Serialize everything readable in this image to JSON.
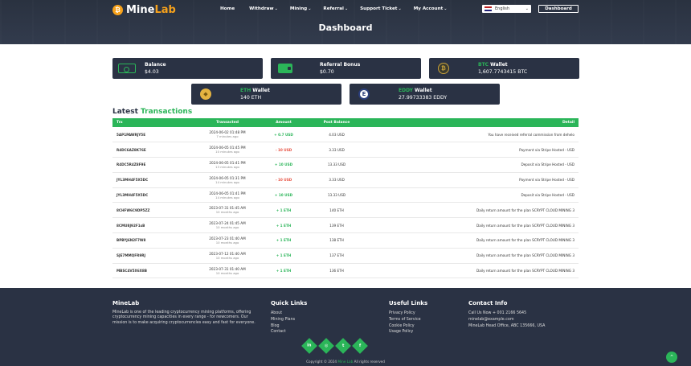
{
  "brand": {
    "logo_glyph": "₿",
    "name_a": "Mine",
    "name_b": "Lab"
  },
  "nav": {
    "items": [
      {
        "label": "Home",
        "chev": ""
      },
      {
        "label": "Withdraw",
        "chev": "⌄"
      },
      {
        "label": "Mining",
        "chev": "⌄"
      },
      {
        "label": "Referral",
        "chev": "⌄"
      },
      {
        "label": "Support Ticket",
        "chev": "⌄"
      },
      {
        "label": "My Account",
        "chev": "⌄"
      }
    ],
    "language": "English",
    "dashboard_button": "Dashboard"
  },
  "page_title": "Dashboard",
  "cards": [
    {
      "label_pre": "",
      "label_acc": "",
      "label": "Balance",
      "value": "$4.03",
      "icon": "cash-icon"
    },
    {
      "label_pre": "",
      "label_acc": "",
      "label": "Referral Bonus",
      "value": "$0.70",
      "icon": "wallet-icon"
    },
    {
      "label_pre": "",
      "label_acc": "BTC",
      "label": " Wallet",
      "value": "1,607.7743415 BTC",
      "icon": "btc-coin-icon"
    },
    {
      "label_pre": "",
      "label_acc": "ETH",
      "label": " Wallet",
      "value": "140 ETH",
      "icon": "eth-coin-icon"
    },
    {
      "label_pre": "",
      "label_acc": "EDDY",
      "label": " Wallet",
      "value": "27.99733383 EDDY",
      "icon": "eddy-coin-icon"
    }
  ],
  "transactions": {
    "title_a": "Latest ",
    "title_b": "Transactions",
    "headers": [
      "Trx",
      "Transacted",
      "Amount",
      "Post Balance",
      "Detail"
    ],
    "rows": [
      {
        "trx": "5AP1PAWRJY5E",
        "date": "2024-06-02 01:48 PM",
        "ago": "7 minutes ago",
        "amount": "+ 0.7 USD",
        "sign": "plus",
        "post": "4.03 USD",
        "detail": "You have received referral commission from dehelo"
      },
      {
        "trx": "R4DC6AZ8K76E",
        "date": "2024-06-05 01:45 PM",
        "ago": "10 minutes ago",
        "amount": "- 10 USD",
        "sign": "minus",
        "post": "3.33 USD",
        "detail": "Payment via Stripe Hosted - USD"
      },
      {
        "trx": "R4DC5R4Z8F9E",
        "date": "2024-06-05 01:41 PM",
        "ago": "13 minutes ago",
        "amount": "+ 10 USD",
        "sign": "plus",
        "post": "13.33 USD",
        "detail": "Deposit via Stripe Hosted - USD"
      },
      {
        "trx": "JYL3MH4F5X5DC",
        "date": "2024-06-05 01:31 PM",
        "ago": "14 minutes ago",
        "amount": "- 10 USD",
        "sign": "minus",
        "post": "3.33 USD",
        "detail": "Payment via Stripe Hosted - USD"
      },
      {
        "trx": "JYL3MH4F5X5DC",
        "date": "2024-06-05 01:41 PM",
        "ago": "14 minutes ago",
        "amount": "+ 10 USD",
        "sign": "plus",
        "post": "13.33 USD",
        "detail": "Deposit via Stripe Hosted - USD"
      },
      {
        "trx": "8CHFW6C9DP5ZZ",
        "date": "2023-07-31 01:45 AM",
        "ago": "10 months ago",
        "amount": "+ 1 ETH",
        "sign": "plus",
        "post": "140 ETH",
        "detail": "Daily return amount for the plan SCRYPT CLOUD MINING 3"
      },
      {
        "trx": "8CMU8J92F1sB",
        "date": "2023-07-24 01:45 AM",
        "ago": "10 months ago",
        "amount": "+ 1 ETH",
        "sign": "plus",
        "post": "139 ETH",
        "detail": "Daily return amount for the plan SCRYPT CLOUD MINING 3"
      },
      {
        "trx": "BPBYJ6N2F7W8",
        "date": "2023-07-23 01:40 AM",
        "ago": "10 months ago",
        "amount": "+ 1 ETH",
        "sign": "plus",
        "post": "138 ETH",
        "detail": "Daily return amount for the plan SCRYPT CLOUD MINING 3"
      },
      {
        "trx": "SJE7MMQFR9RJ",
        "date": "2023-07-12 01:40 AM",
        "ago": "10 months ago",
        "amount": "+ 1 ETH",
        "sign": "plus",
        "post": "137 ETH",
        "detail": "Daily return amount for the plan SCRYPT CLOUD MINING 3"
      },
      {
        "trx": "MBSC4V5X6X8B",
        "date": "2023-07-31 01:40 AM",
        "ago": "10 months ago",
        "amount": "+ 1 ETH",
        "sign": "plus",
        "post": "136 ETH",
        "detail": "Daily return amount for the plan SCRYPT CLOUD MINING 3"
      }
    ]
  },
  "footer": {
    "about_title": "MineLab",
    "about_text": "MineLab is one of the leading cryptocurrency mining platforms, offering cryptocurrency mining capacities in every range - for newcomers. Our mission is to make acquiring cryptocurrencies easy and fast for everyone.",
    "quick_title": "Quick Links",
    "quick_links": [
      "About",
      "Mining Plans",
      "Blog",
      "Contact"
    ],
    "useful_title": "Useful Links",
    "useful_links": [
      "Privacy Policy",
      "Terms of Service",
      "Cookie Policy",
      "Usage Policy"
    ],
    "contact_title": "Contact Info",
    "contact_lines": [
      "Call Us Now + 001 2166 5645",
      "minelab@example.com",
      "MineLab Head Office, ABC 135666, USA"
    ],
    "social": [
      {
        "name": "linkedin-icon",
        "glyph": "in"
      },
      {
        "name": "instagram-icon",
        "glyph": "◎"
      },
      {
        "name": "twitter-icon",
        "glyph": "t"
      },
      {
        "name": "facebook-icon",
        "glyph": "f"
      }
    ],
    "copyright_a": "Copyright © 2024 ",
    "copyright_b": "Mine Lab",
    "copyright_c": " All rights reserved"
  },
  "colors": {
    "accent": "#2bb559",
    "brand_orange": "#f7a21b",
    "dark": "#2a3244"
  }
}
